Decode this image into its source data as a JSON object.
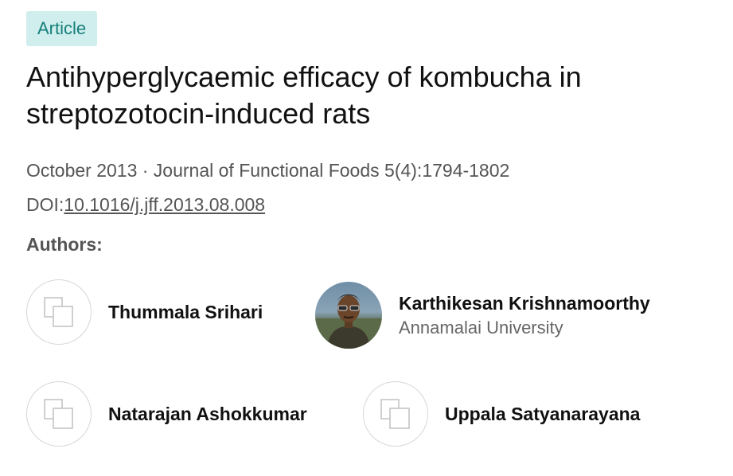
{
  "badge": "Article",
  "title": "Antihyperglycaemic efficacy of kombucha in streptozotocin-induced rats",
  "meta": "October 2013 · Journal of Functional Foods 5(4):1794-1802",
  "doi": {
    "label": "DOI:",
    "value": "10.1016/j.jff.2013.08.008"
  },
  "authors_heading": "Authors:",
  "authors": [
    {
      "name": "Thummala Srihari",
      "affiliation": "",
      "avatar": "placeholder-icon"
    },
    {
      "name": "Karthikesan Krishnamoorthy",
      "affiliation": "Annamalai University",
      "avatar": "photo"
    },
    {
      "name": "Natarajan Ashokkumar",
      "affiliation": "",
      "avatar": "placeholder-icon"
    },
    {
      "name": "Uppala Satyanarayana",
      "affiliation": "",
      "avatar": "placeholder-icon"
    }
  ],
  "colors": {
    "badge_bg": "#cfeeed",
    "badge_text": "#157f7a",
    "meta_text": "#555555"
  }
}
